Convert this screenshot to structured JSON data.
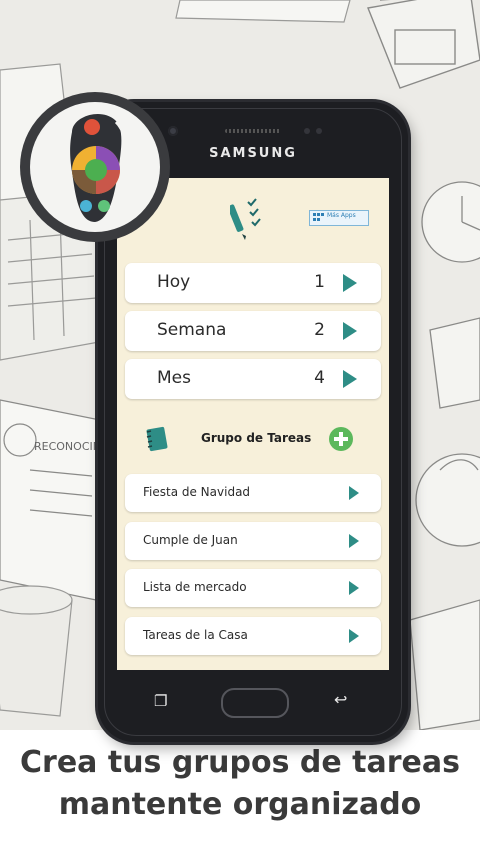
{
  "device": {
    "brand": "SAMSUNG"
  },
  "promo": {
    "line1": "Crea tus grupos de tareas",
    "line2": "mantente organizado"
  },
  "top": {
    "more_apps_label": "Más Apps"
  },
  "periods": [
    {
      "label": "Hoy",
      "count": "1"
    },
    {
      "label": "Semana",
      "count": "2"
    },
    {
      "label": "Mes",
      "count": "4"
    }
  ],
  "groups": {
    "title": "Grupo de Tareas",
    "items": [
      {
        "label": "Fiesta de Navidad"
      },
      {
        "label": "Cumple de Juan"
      },
      {
        "label": "Lista de mercado"
      },
      {
        "label": "Tareas de la Casa"
      }
    ]
  },
  "icons": {
    "app_logo": "pen-checklist-icon",
    "more_apps": "apps-grid-icon",
    "period_arrow": "play-arrow-icon",
    "group": "notebook-icon",
    "add": "plus-circle-icon",
    "nav_recent": "recent-apps-icon",
    "nav_back": "back-arrow-icon",
    "overlay": "remote-control-app-icon"
  },
  "colors": {
    "screen_bg": "#f7f0da",
    "accent_teal": "#2e8d86",
    "add_green": "#5cb85c",
    "phone_body": "#1d1e22"
  }
}
